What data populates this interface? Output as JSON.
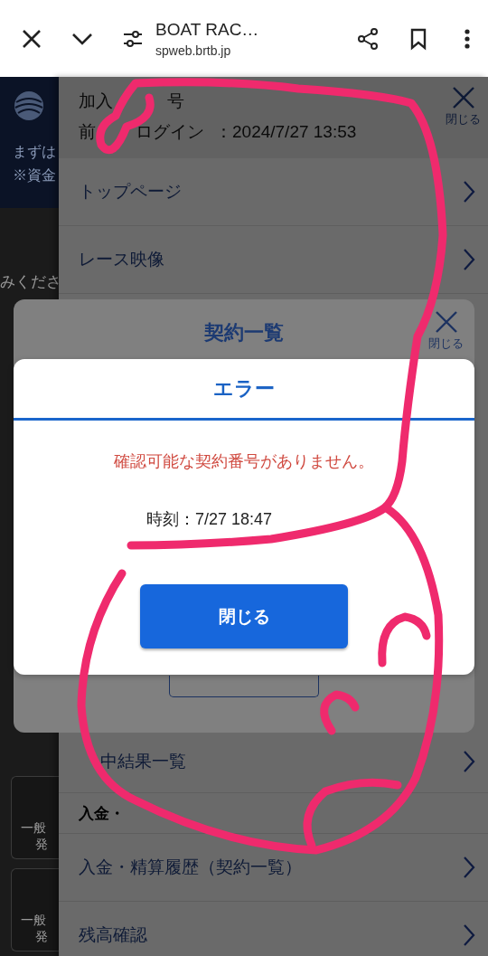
{
  "browser_bar": {
    "title": "BOAT RAC…",
    "url": "spweb.brtb.jp"
  },
  "background_page": {
    "header_texts": [
      "まずは",
      "※資金"
    ],
    "body_text": "みくださ",
    "cards": [
      {
        "line_1": "一般",
        "line_2": "発"
      },
      {
        "line_1": "一般",
        "line_2": "発"
      }
    ]
  },
  "side_menu": {
    "member_label_parts": [
      "加入",
      "号"
    ],
    "last_login_label_parts": [
      "前",
      "ログイン"
    ],
    "last_login_value": "：2024/7/27 13:53",
    "close_label": "閉じる",
    "items_top": [
      {
        "kind": "link",
        "label": "トップページ"
      },
      {
        "kind": "link",
        "label": "レース映像"
      }
    ],
    "items_bottom": [
      {
        "kind": "link",
        "label": "中結果一覧"
      },
      {
        "kind": "heading",
        "label": "入金・"
      },
      {
        "kind": "link",
        "label": "入金・精算履歴（契約一覧）"
      },
      {
        "kind": "link",
        "label": "残高確認"
      }
    ]
  },
  "contract_modal": {
    "title": "契約一覧",
    "close_label": "閉じる"
  },
  "error_dialog": {
    "title": "エラー",
    "message": "確認可能な契約番号がありません。",
    "time": "時刻：7/27 18:47",
    "button_label": "閉じる"
  }
}
